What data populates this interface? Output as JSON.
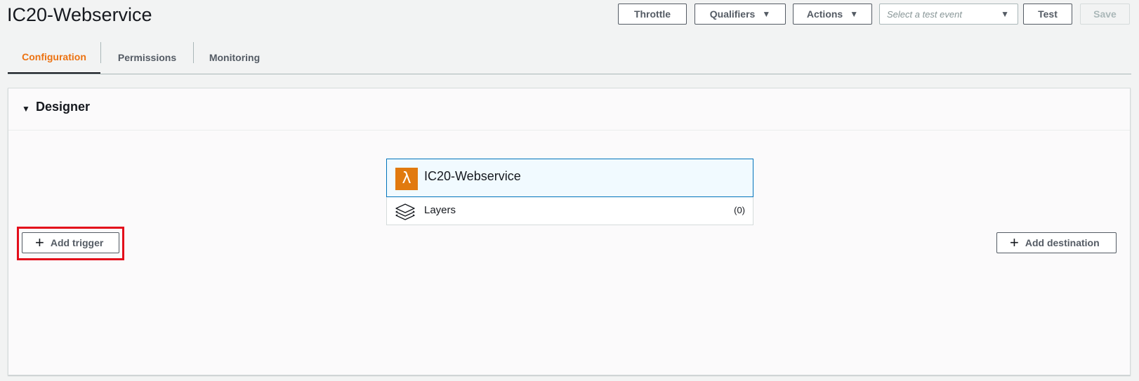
{
  "header": {
    "title": "IC20-Webservice",
    "buttons": {
      "throttle": "Throttle",
      "qualifiers": "Qualifiers",
      "actions": "Actions",
      "test": "Test",
      "save": "Save"
    },
    "test_event_select": {
      "placeholder": "Select a test event"
    }
  },
  "tabs": [
    {
      "label": "Configuration",
      "active": true
    },
    {
      "label": "Permissions",
      "active": false
    },
    {
      "label": "Monitoring",
      "active": false
    }
  ],
  "designer": {
    "title": "Designer",
    "function": {
      "name": "IC20-Webservice",
      "icon": "lambda-icon",
      "layers_label": "Layers",
      "layers_count": "(0)"
    },
    "add_trigger_label": "Add trigger",
    "add_destination_label": "Add destination"
  },
  "colors": {
    "accent_tab": "#ec7211",
    "lambda_orange": "#e17a0f",
    "selected_border": "#0073bb",
    "highlight_red": "#e30d1b"
  }
}
